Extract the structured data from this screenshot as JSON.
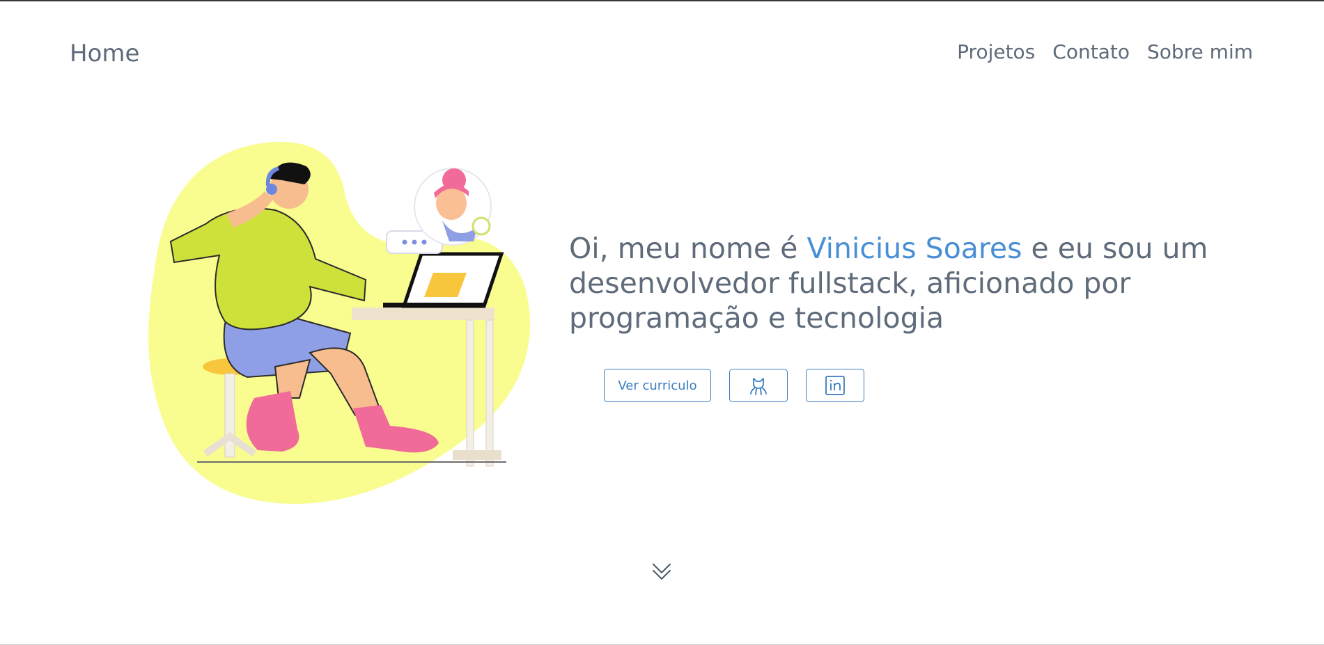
{
  "nav": {
    "home_label": "Home",
    "links": [
      "Projetos",
      "Contato",
      "Sobre mim"
    ]
  },
  "hero": {
    "intro": "Oi, meu nome é",
    "name": "Vinicius Soares",
    "rest": "e eu sou um desenvolvedor fullstack, aficionado por programação e tecnologia"
  },
  "actions": {
    "cv_label": "Ver curriculo",
    "github_icon": "github-icon",
    "linkedin_icon": "linkedin-icon"
  },
  "scroll_icon": "chevrons-down-icon",
  "colors": {
    "text": "#5f6b7a",
    "accent": "#4a8fd4",
    "button_border": "#3a7cc0",
    "blob": "#f9fd8f"
  }
}
